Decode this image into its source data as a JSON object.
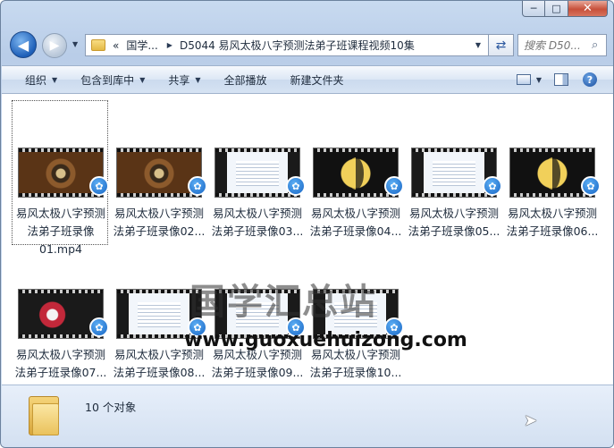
{
  "window": {
    "minimize": "─",
    "maximize": "□",
    "close": "✕"
  },
  "nav": {
    "back_arrow": "◀",
    "forward_arrow": "▶",
    "breadcrumb": [
      "«",
      "国学...",
      "D5044 易风太极八字预测法弟子班课程视频10集"
    ],
    "search_placeholder": "搜索 D50..."
  },
  "toolbar": {
    "organize": "组织",
    "include_library": "包含到库中",
    "share": "共享",
    "play_all": "全部播放",
    "new_folder": "新建文件夹",
    "help": "?"
  },
  "files": [
    {
      "line1": "易风太极八字预测",
      "line2": "法弟子班录像",
      "line3": "01.mp4",
      "thumb": "wood"
    },
    {
      "line1": "易风太极八字预测",
      "line2": "法弟子班录像02...",
      "line3": "",
      "thumb": "wood"
    },
    {
      "line1": "易风太极八字预测",
      "line2": "法弟子班录像03...",
      "line3": "",
      "thumb": "doc"
    },
    {
      "line1": "易风太极八字预测",
      "line2": "法弟子班录像04...",
      "line3": "",
      "thumb": "yinyang"
    },
    {
      "line1": "易风太极八字预测",
      "line2": "法弟子班录像05...",
      "line3": "",
      "thumb": "doc"
    },
    {
      "line1": "易风太极八字预测",
      "line2": "法弟子班录像06...",
      "line3": "",
      "thumb": "yinyang"
    },
    {
      "line1": "易风太极八字预测",
      "line2": "法弟子班录像07...",
      "line3": "",
      "thumb": "red"
    },
    {
      "line1": "易风太极八字预测",
      "line2": "法弟子班录像08...",
      "line3": "",
      "thumb": "doc"
    },
    {
      "line1": "易风太极八字预测",
      "line2": "法弟子班录像09...",
      "line3": "",
      "thumb": "doc"
    },
    {
      "line1": "易风太极八字预测",
      "line2": "法弟子班录像10...",
      "line3": "",
      "thumb": "doc"
    }
  ],
  "watermark": {
    "cn": "国学汇总站",
    "url": "www.guoxuehuizong.com"
  },
  "details": {
    "count": "10 个对象"
  }
}
